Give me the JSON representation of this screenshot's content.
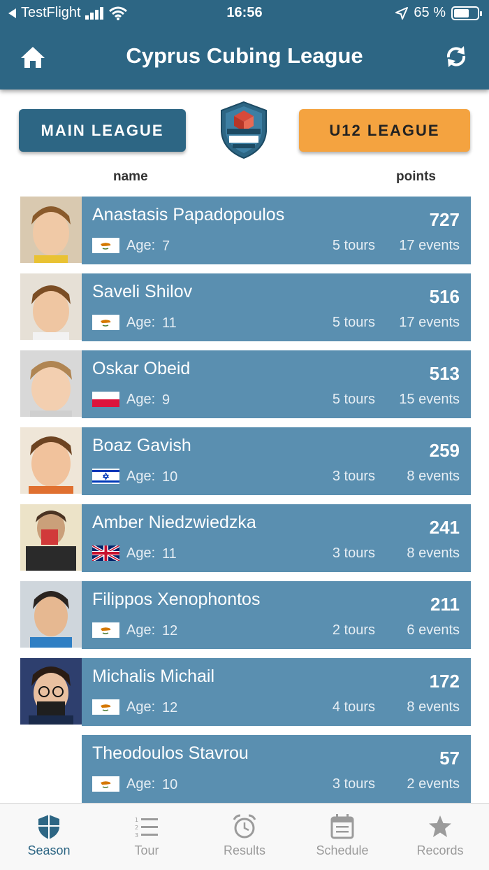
{
  "status_bar": {
    "back_app": "TestFlight",
    "time": "16:56",
    "battery": "65 %",
    "battery_level": 0.65
  },
  "header": {
    "title": "Cyprus Cubing League"
  },
  "leagues": {
    "main_label": "MAIN LEAGUE",
    "u12_label": "U12 LEAGUE",
    "selected": "U12 LEAGUE"
  },
  "logo": {
    "text": "CYPRUS CUBING LEAGUE"
  },
  "columns": {
    "name": "name",
    "points": "points"
  },
  "age_label": "Age:",
  "players": [
    {
      "name": "Anastasis Papadopoulos",
      "points": "727",
      "age": "7",
      "tours": "5 tours",
      "events": "17 events",
      "flag": "cyprus-flag-icon"
    },
    {
      "name": "Saveli Shilov",
      "points": "516",
      "age": "11",
      "tours": "5 tours",
      "events": "17 events",
      "flag": "cyprus-flag-icon"
    },
    {
      "name": "Oskar Obeid",
      "points": "513",
      "age": "9",
      "tours": "5 tours",
      "events": "15 events",
      "flag": "poland-flag-icon"
    },
    {
      "name": "Boaz Gavish",
      "points": "259",
      "age": "10",
      "tours": "3 tours",
      "events": "8 events",
      "flag": "israel-flag-icon"
    },
    {
      "name": "Amber Niedzwiedzka",
      "points": "241",
      "age": "11",
      "tours": "3 tours",
      "events": "8 events",
      "flag": "uk-flag-icon"
    },
    {
      "name": "Filippos Xenophontos",
      "points": "211",
      "age": "12",
      "tours": "2 tours",
      "events": "6 events",
      "flag": "cyprus-flag-icon"
    },
    {
      "name": "Michalis Michail",
      "points": "172",
      "age": "12",
      "tours": "4 tours",
      "events": "8 events",
      "flag": "cyprus-flag-icon"
    },
    {
      "name": "Theodoulos Stavrou",
      "points": "57",
      "age": "10",
      "tours": "3 tours",
      "events": "2 events",
      "flag": "cyprus-flag-icon"
    }
  ],
  "tabs": [
    {
      "label": "Season",
      "icon": "shield-icon",
      "active": true
    },
    {
      "label": "Tour",
      "icon": "numbered-list-icon",
      "active": false
    },
    {
      "label": "Results",
      "icon": "alarm-clock-icon",
      "active": false
    },
    {
      "label": "Schedule",
      "icon": "calendar-icon",
      "active": false
    },
    {
      "label": "Records",
      "icon": "star-icon",
      "active": false
    }
  ],
  "colors": {
    "header": "#2d6684",
    "card": "#5a8fb0",
    "u12_button": "#f4a340",
    "tab_active": "#2d6684",
    "tab_inactive": "#9b9b9b"
  }
}
